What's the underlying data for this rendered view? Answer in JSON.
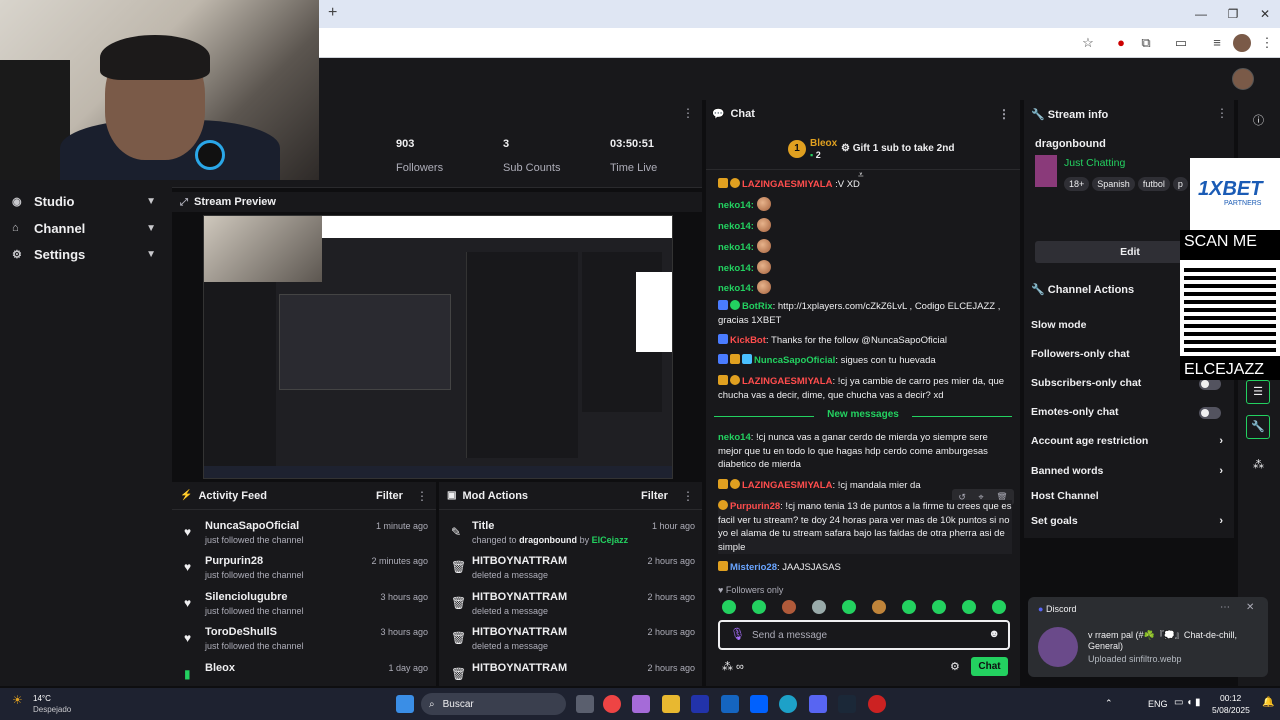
{
  "stats": [
    {
      "value": "903",
      "label": "Followers"
    },
    {
      "value": "3",
      "label": "Sub Counts"
    },
    {
      "value": "03:50:51",
      "label": "Time Live"
    }
  ],
  "stats_partial_label": "s",
  "nav": [
    {
      "label": "Studio",
      "icon": "studio-icon"
    },
    {
      "label": "Channel",
      "icon": "channel-icon"
    },
    {
      "label": "Settings",
      "icon": "gear-icon"
    }
  ],
  "preview": {
    "title": "Stream Preview"
  },
  "activity": {
    "title": "Activity Feed",
    "filter": "Filter",
    "items": [
      {
        "name": "NuncaSapoOficial",
        "sub": "just followed the channel",
        "time": "1 minute ago"
      },
      {
        "name": "Purpurin28",
        "sub": "just followed the channel",
        "time": "2 minutes ago"
      },
      {
        "name": "Silenciolugubre",
        "sub": "just followed the channel",
        "time": "3 hours ago"
      },
      {
        "name": "ToroDeShullS",
        "sub": "just followed the channel",
        "time": "3 hours ago"
      },
      {
        "name": "Bleox",
        "sub": "",
        "time": "1 day ago"
      }
    ]
  },
  "mod": {
    "title": "Mod Actions",
    "filter": "Filter",
    "items": [
      {
        "name": "Title",
        "sub_prefix": "changed to",
        "sub_target": "dragonbound",
        "sub_by": "by",
        "sub_user": "ElCejazz",
        "time": "1 hour ago"
      },
      {
        "name": "HITBOYNATTRAM",
        "sub": "deleted a message",
        "time": "2 hours ago"
      },
      {
        "name": "HITBOYNATTRAM",
        "sub": "deleted a message",
        "time": "2 hours ago"
      },
      {
        "name": "HITBOYNATTRAM",
        "sub": "deleted a message",
        "time": "2 hours ago"
      },
      {
        "name": "HITBOYNATTRAM",
        "sub": "",
        "time": "2 hours ago"
      }
    ]
  },
  "chat": {
    "title": "Chat",
    "pin": {
      "rank": "1",
      "user": "Bleox",
      "count": "2",
      "text": "Gift 1 sub to take 2nd"
    },
    "top_user": "LAZINGAESMIYALA",
    "top_text": ":V XD",
    "neko": [
      "neko14:",
      "neko14:",
      "neko14:",
      "neko14:",
      "neko14:"
    ],
    "messages": [
      {
        "user": "BotRix",
        "text": ": http://1xplayers.com/cZkZ6LvL , Codigo ELCEJAZZ , gracias 1XBET"
      },
      {
        "user": "KickBot",
        "text": ": Thanks for the follow @NuncaSapoOficial"
      },
      {
        "user": "NuncaSapoOficial",
        "text": ": sigues con tu huevada"
      },
      {
        "user": "LAZINGAESMIYALA",
        "text": ": !cj ya cambie de carro pes mier da, que chucha vas a decir, dime, que chucha vas a decir? xd"
      }
    ],
    "new_messages": "New messages",
    "messages2": [
      {
        "user": "neko14",
        "text": ": !cj nunca vas a ganar cerdo de mierda yo siempre sere mejor que tu en todo lo que hagas hdp cerdo come amburgesas diabetico de mierda"
      },
      {
        "user": "LAZINGAESMIYALA",
        "text": ": !cj mandala mier da"
      },
      {
        "user": "Purpurin28",
        "text": ": !cj mano tenia 13 de puntos a la firme tu crees que es facil ver tu stream? te doy 24 horas para ver mas de 10k puntos si no yo el alama de tu stream safara bajo las faldas de otra pherra asi de simple"
      },
      {
        "user": "Misterio28",
        "text": ": JAAJSJASAS"
      }
    ],
    "followers_only": "Followers only",
    "input_placeholder": "Send a message",
    "send_label": "Chat"
  },
  "info": {
    "title": "Stream info",
    "stream_title": "dragonbound",
    "category": "Just Chatting",
    "tags": [
      "18+",
      "Spanish",
      "futbol",
      "p"
    ],
    "edit_label": "Edit"
  },
  "actions": {
    "title": "Channel Actions",
    "items": [
      {
        "label": "Slow mode"
      },
      {
        "label": "Followers-only chat"
      },
      {
        "label": "Subscribers-only chat"
      },
      {
        "label": "Emotes-only chat"
      },
      {
        "label": "Account age restriction"
      },
      {
        "label": "Banned words"
      },
      {
        "label": "Host Channel"
      },
      {
        "label": "Set goals"
      }
    ]
  },
  "overlay": {
    "brand": "1XBET",
    "brand_sub": "PARTNERS",
    "scan": "SCAN ME",
    "code": "ELCEJAZZ"
  },
  "discord": {
    "app": "Discord",
    "line1": "v rraem pal (#☘️『💭』Chat-de-chill,",
    "line2": "General)",
    "line3": "Uploaded sinfiltro.webp"
  },
  "taskbar": {
    "weather_temp": "14°C",
    "weather_desc": "Despejado",
    "search": "Buscar",
    "lang": "ENG",
    "time": "00:12",
    "date": "5/08/2025"
  },
  "colors": {
    "accent": "#23d160",
    "bg": "#18181b",
    "page": "#0e0e10"
  }
}
